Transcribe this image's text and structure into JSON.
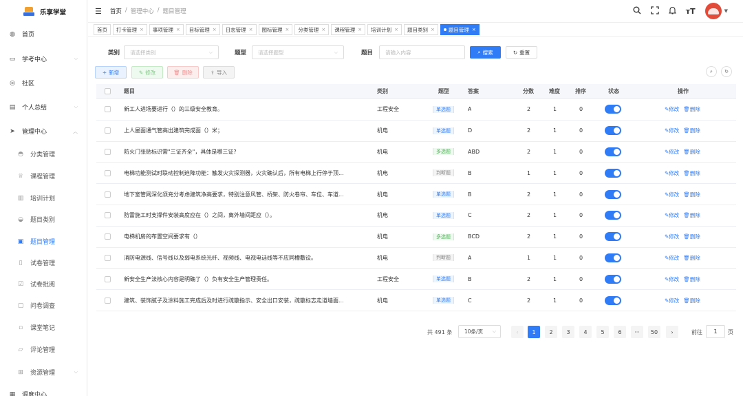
{
  "app": {
    "name": "乐享学堂"
  },
  "sidebar": {
    "items": [
      {
        "label": "首页",
        "icon": "dashboard-icon",
        "glyph": "◍",
        "arrow": ""
      },
      {
        "label": "学考中心",
        "icon": "monitor-icon",
        "glyph": "▭",
        "arrow": "⌵"
      },
      {
        "label": "社区",
        "icon": "globe-icon",
        "glyph": "◎",
        "arrow": ""
      },
      {
        "label": "个人总结",
        "icon": "calendar-icon",
        "glyph": "▤",
        "arrow": "⌵"
      },
      {
        "label": "管理中心",
        "icon": "send-icon",
        "glyph": "➤",
        "arrow": "︿"
      },
      {
        "label": "分类管理",
        "icon": "folder-icon",
        "glyph": "◓",
        "arrow": "",
        "sub": true
      },
      {
        "label": "课程管理",
        "icon": "trophy-icon",
        "glyph": "♕",
        "arrow": "",
        "sub": true
      },
      {
        "label": "培训计划",
        "icon": "book-icon",
        "glyph": "▥",
        "arrow": "",
        "sub": true
      },
      {
        "label": "题目类别",
        "icon": "category-icon",
        "glyph": "◒",
        "arrow": "",
        "sub": true
      },
      {
        "label": "题目管理",
        "icon": "list-icon",
        "glyph": "▣",
        "arrow": "",
        "sub": true,
        "active": true
      },
      {
        "label": "试卷管理",
        "icon": "paper-icon",
        "glyph": "▯",
        "arrow": "",
        "sub": true
      },
      {
        "label": "试卷批阅",
        "icon": "check-icon",
        "glyph": "☑",
        "arrow": "",
        "sub": true
      },
      {
        "label": "问卷调查",
        "icon": "survey-icon",
        "glyph": "▢",
        "arrow": "",
        "sub": true
      },
      {
        "label": "课堂笔记",
        "icon": "note-icon",
        "glyph": "▫",
        "arrow": "",
        "sub": true
      },
      {
        "label": "评论管理",
        "icon": "comment-icon",
        "glyph": "▱",
        "arrow": "",
        "sub": true
      },
      {
        "label": "资源管理",
        "icon": "resource-icon",
        "glyph": "⊞",
        "arrow": "⌵",
        "sub": true
      },
      {
        "label": "调度中心",
        "icon": "schedule-icon",
        "glyph": "▦",
        "arrow": ""
      }
    ]
  },
  "header": {
    "breadcrumb": [
      "首页",
      "/",
      "管理中心",
      "/",
      "题目管理"
    ],
    "tools": {
      "font_label": "тT"
    }
  },
  "tags": [
    {
      "label": "首页",
      "closable": false
    },
    {
      "label": "打卡管理",
      "closable": true
    },
    {
      "label": "事项管理",
      "closable": true
    },
    {
      "label": "目标管理",
      "closable": true
    },
    {
      "label": "日志管理",
      "closable": true
    },
    {
      "label": "图标管理",
      "closable": true
    },
    {
      "label": "分类管理",
      "closable": true
    },
    {
      "label": "课程管理",
      "closable": true
    },
    {
      "label": "培训计划",
      "closable": true
    },
    {
      "label": "题目类别",
      "closable": true
    },
    {
      "label": "题目管理",
      "closable": true,
      "active": true
    }
  ],
  "filters": {
    "category_label": "类别",
    "category_placeholder": "请选择类别",
    "type_label": "题型",
    "type_placeholder": "请选择题型",
    "question_label": "题目",
    "question_placeholder": "请输入内容",
    "search_label": "搜索",
    "reset_label": "重置"
  },
  "actions": {
    "add": "新增",
    "edit": "修改",
    "delete": "删除",
    "import": "导入"
  },
  "table": {
    "columns": [
      "题目",
      "类别",
      "题型",
      "答案",
      "分数",
      "难度",
      "排序",
      "状态",
      "操作"
    ],
    "op_edit": "修改",
    "op_delete": "删除",
    "rows": [
      {
        "title": "新工人进场要进行（）的三级安全教育。",
        "category": "工程安全",
        "type": "单选题",
        "type_kind": "single",
        "answer": "A",
        "score": "2",
        "difficulty": "1",
        "sort": "0"
      },
      {
        "title": "上人屋面通气管高出建筑完成面（）米；",
        "category": "机电",
        "type": "单选题",
        "type_kind": "single",
        "answer": "D",
        "score": "2",
        "difficulty": "1",
        "sort": "0"
      },
      {
        "title": "防火门张贴标识需\"三证齐全\"，具体是哪三证?",
        "category": "机电",
        "type": "多选题",
        "type_kind": "multi",
        "answer": "ABD",
        "score": "2",
        "difficulty": "1",
        "sort": "0"
      },
      {
        "title": "电梯功能测试时联动控制迫降功能：触发火灾探测器，火灾确认后，所有电梯上行停于顶...",
        "category": "机电",
        "type": "判断题",
        "type_kind": "judge",
        "answer": "B",
        "score": "1",
        "difficulty": "1",
        "sort": "0"
      },
      {
        "title": "地下室管网深化须充分考虑建筑净高要求，特别注意风管、桥架、防火卷帘、车位、车道...",
        "category": "机电",
        "type": "单选题",
        "type_kind": "single",
        "answer": "B",
        "score": "2",
        "difficulty": "1",
        "sort": "0"
      },
      {
        "title": "防雷施工时支撑件安装高度应在（）之间，离外墙间距应（）。",
        "category": "机电",
        "type": "单选题",
        "type_kind": "single",
        "answer": "C",
        "score": "2",
        "difficulty": "1",
        "sort": "0"
      },
      {
        "title": "电梯机房的布置空间要求有（）",
        "category": "机电",
        "type": "多选题",
        "type_kind": "multi",
        "answer": "BCD",
        "score": "2",
        "difficulty": "1",
        "sort": "0"
      },
      {
        "title": "消防电源线、信号线以及弱电系统光纤、视频线、电视电话线等不应同槽敷设。",
        "category": "机电",
        "type": "判断题",
        "type_kind": "judge",
        "answer": "A",
        "score": "1",
        "difficulty": "1",
        "sort": "0"
      },
      {
        "title": "新安全生产法核心内容是明确了（）负有安全生产管理责任。",
        "category": "工程安全",
        "type": "单选题",
        "type_kind": "single",
        "answer": "B",
        "score": "2",
        "difficulty": "1",
        "sort": "0"
      },
      {
        "title": "建筑、装饰腻子及涂料施工完成后及时进行疏散指示、安全出口安装，疏散标志走道墙面...",
        "category": "机电",
        "type": "单选题",
        "type_kind": "single",
        "answer": "C",
        "score": "2",
        "difficulty": "1",
        "sort": "0"
      }
    ]
  },
  "pagination": {
    "total_label": "共 491 条",
    "page_size": "10条/页",
    "pages": [
      "1",
      "2",
      "3",
      "4",
      "5",
      "6",
      "···",
      "50"
    ],
    "current": "1",
    "goto_label": "前往",
    "goto_value": "1",
    "unit_label": "页"
  },
  "colors": {
    "primary": "#2f7cf6",
    "avatar": "#e14b3a"
  }
}
